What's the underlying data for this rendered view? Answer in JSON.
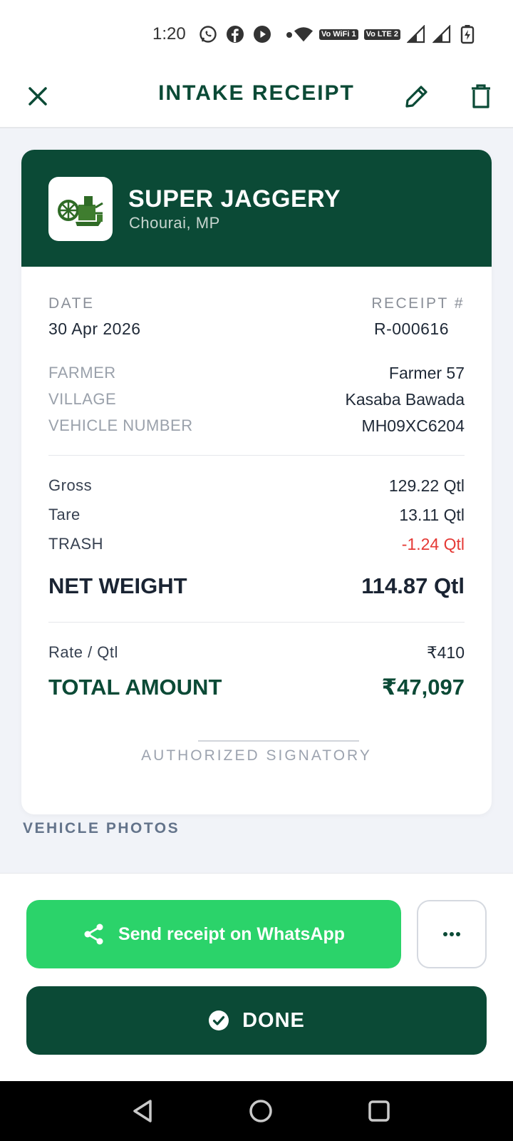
{
  "status_bar": {
    "time": "1:20",
    "icons": [
      "whatsapp-icon",
      "facebook-icon",
      "youtube-icon",
      "dot-icon",
      "wifi-icon",
      "vowifi-icon",
      "volte-icon",
      "signal-icon",
      "signal-icon",
      "battery-charging-icon"
    ],
    "vowifi_label": "Vo WiFi 1",
    "volte_label": "Vo LTE 2"
  },
  "header": {
    "title": "INTAKE RECEIPT",
    "close_icon": "close-icon",
    "edit_icon": "pencil-icon",
    "delete_icon": "trash-icon"
  },
  "receipt": {
    "business_name": "SUPER JAGGERY",
    "business_location": "Chourai, MP",
    "date_label": "DATE",
    "date_value": "30 Apr 2026",
    "receipt_label": "RECEIPT #",
    "receipt_value": "R-000616",
    "details": [
      {
        "label": "FARMER",
        "value": "Farmer 57"
      },
      {
        "label": "VILLAGE",
        "value": "Kasaba Bawada"
      },
      {
        "label": "VEHICLE NUMBER",
        "value": "MH09XC6204"
      }
    ],
    "weights": [
      {
        "label": "Gross",
        "value": "129.22 Qtl"
      },
      {
        "label": "Tare",
        "value": "13.11 Qtl"
      },
      {
        "label": "TRASH",
        "value": "-1.24 Qtl"
      }
    ],
    "net_weight_label": "NET WEIGHT",
    "net_weight_value": "114.87 Qtl",
    "rate_label": "Rate / Qtl",
    "rate_value": "₹410",
    "total_label": "TOTAL AMOUNT",
    "total_value": "₹47,097",
    "signatory_label": "AUTHORIZED SIGNATORY"
  },
  "vehicle_photos": {
    "title": "VEHICLE PHOTOS"
  },
  "actions": {
    "whatsapp_label": "Send receipt on WhatsApp",
    "more_label": "•••",
    "done_label": "DONE"
  },
  "colors": {
    "brand": "#0b4a36",
    "whatsapp": "#2bd36a",
    "negative": "#e53935"
  }
}
